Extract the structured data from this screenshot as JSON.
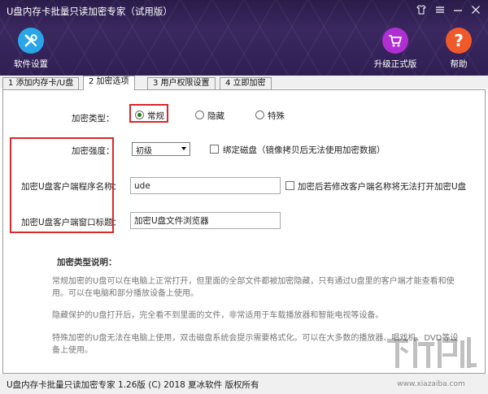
{
  "window": {
    "title": "U盘内存卡批量只读加密专家（试用版）",
    "controls": [
      "shirt-icon",
      "menu-icon",
      "minimize-icon",
      "close-icon"
    ]
  },
  "header": {
    "settings": {
      "label": "软件设置",
      "color": "#2aa6e8"
    },
    "upgrade": {
      "label": "升级正式版",
      "color": "#b02fd3"
    },
    "help": {
      "label": "帮助",
      "color": "#f05a2a"
    }
  },
  "tabs": [
    {
      "label": "1 添加内存卡/U盘",
      "active": false
    },
    {
      "label": "2 加密选项",
      "active": true
    },
    {
      "label": "3 用户权限设置",
      "active": false
    },
    {
      "label": "4 立即加密",
      "active": false
    }
  ],
  "encryption": {
    "type_label": "加密类型：",
    "types": [
      "常规",
      "隐藏",
      "特殊"
    ],
    "selected_type": "常规",
    "strength_label": "加密强度：",
    "strength_value": "初级",
    "bind_disk_label": "绑定磁盘（镜像拷贝后无法使用加密数据）",
    "client_name_label": "加密U盘客户端程序名称：",
    "client_name_value": "ude",
    "rename_warn_label": "加密后若修改客户端名称将无法打开加密U盘",
    "window_title_label": "加密U盘客户端窗口标题：",
    "window_title_value": "加密U盘文件浏览器"
  },
  "explanation": {
    "heading": "加密类型说明：",
    "paragraphs": [
      "常规加密的U盘可以在电脑上正常打开，但里面的全部文件都被加密隐藏，只有通过U盘里的客户端才能查看和使用。可以在电脑和部分播放设备上使用。",
      "隐藏保护的U盘打开后，完全看不到里面的文件，非常适用于车载播放器和智能电视等设备。",
      "特殊加密的U盘无法在电脑上使用，双击磁盘系统会提示需要格式化。可以在大多数的播放器、唱戏机、DVD等设备上使用。"
    ]
  },
  "footer": {
    "copyright": "U盘内存卡批量只读加密专家 1.26版 (C) 2018 夏冰软件 版权所有"
  },
  "watermark": {
    "text": "下载吧",
    "url": "www.xiazaiba.com"
  }
}
